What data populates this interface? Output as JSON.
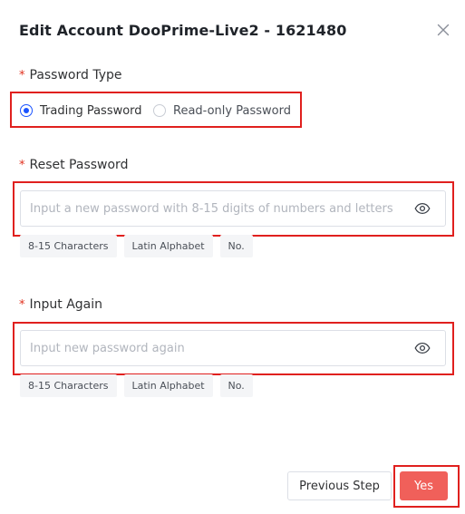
{
  "dialog": {
    "title": "Edit Account DooPrime-Live2 - 1621480",
    "close_icon": "close-icon"
  },
  "password_type": {
    "required_mark": "*",
    "label": "Password Type",
    "options": [
      {
        "label": "Trading Password",
        "checked": true
      },
      {
        "label": "Read-only Password",
        "checked": false
      }
    ]
  },
  "reset_password": {
    "required_mark": "*",
    "label": "Reset Password",
    "value": "",
    "placeholder": "Input a new password with 8-15 digits of numbers and letters",
    "toggle_icon": "eye-icon",
    "hints": [
      "8-15 Characters",
      "Latin Alphabet",
      "No."
    ]
  },
  "input_again": {
    "required_mark": "*",
    "label": "Input Again",
    "value": "",
    "placeholder": "Input new password again",
    "toggle_icon": "eye-icon",
    "hints": [
      "8-15 Characters",
      "Latin Alphabet",
      "No."
    ]
  },
  "footer": {
    "previous_label": "Previous Step",
    "yes_label": "Yes"
  },
  "colors": {
    "accent_blue": "#1a53ff",
    "primary_button": "#f0605a",
    "required": "#e0301e",
    "highlight_border": "#e0201e"
  }
}
